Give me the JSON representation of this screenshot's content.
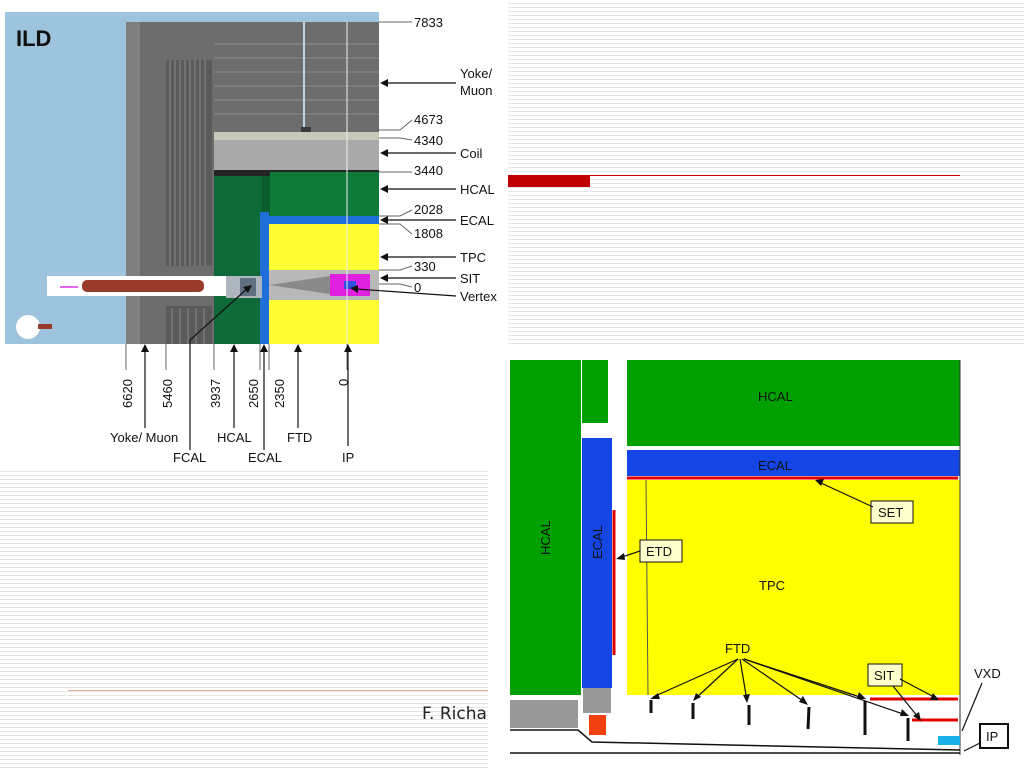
{
  "slide": {
    "author": "F. Richa",
    "colors": {
      "accent": "#c00000"
    }
  },
  "ild_figure": {
    "title": "ILD",
    "right_dims": [
      "7833",
      "4673",
      "4340",
      "3440",
      "2028",
      "1808",
      "330",
      "0"
    ],
    "right_labels": {
      "yoke": "Yoke/",
      "muon": "Muon",
      "coil": "Coil",
      "hcal": "HCAL",
      "ecal": "ECAL",
      "tpc": "TPC",
      "sit": "SIT",
      "vertex": "Vertex"
    },
    "bottom_dims": [
      "6620",
      "5460",
      "3937",
      "2650",
      "2350",
      "0"
    ],
    "bottom_labels": {
      "yoke_muon": "Yoke/ Muon",
      "hcal": "HCAL",
      "ftd": "FTD",
      "fcal": "FCAL",
      "ecal": "ECAL",
      "ip": "IP"
    },
    "colors": {
      "background": "#9ec3dc",
      "iron": "#6d6d6d",
      "coil": "#a9a9a9",
      "hcal": "#0f7a3a",
      "ecal": "#1f6fd8",
      "tpc": "#ffff33",
      "vertex": "#e020e0"
    }
  },
  "detector_figure": {
    "labels": {
      "hcal_top": "HCAL",
      "ecal_top": "ECAL",
      "set": "SET",
      "hcal_left": "HCAL",
      "ecal_left": "ECAL",
      "etd": "ETD",
      "tpc": "TPC",
      "ftd": "FTD",
      "sit": "SIT",
      "vxd": "VXD",
      "ip": "IP"
    },
    "colors": {
      "hcal": "#00a000",
      "ecal": "#1446e6",
      "tpc": "#ffff00",
      "trackers": "#e00000",
      "gray": "#999999",
      "fcal": "#f04010",
      "vxd": "#1cb0e8"
    }
  }
}
